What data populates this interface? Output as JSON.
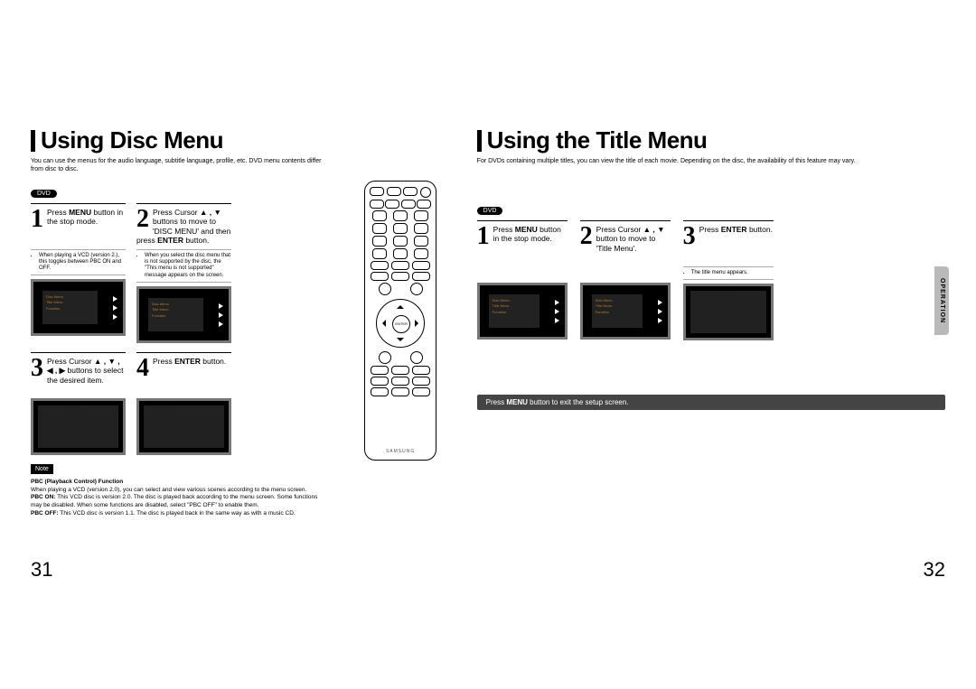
{
  "left": {
    "title": "Using Disc Menu",
    "intro": "You can use the menus for the audio language, subtitle language, profile, etc.\nDVD menu contents differ from disc to disc.",
    "badge": "DVD",
    "steps": [
      {
        "num": "1",
        "text_pre": "Press ",
        "text_b": "MENU",
        "text_post": " button in the stop mode.",
        "note": "When playing a VCD (version 2.), this toggles between PBC ON and OFF."
      },
      {
        "num": "2",
        "text_pre": "Press Cursor ",
        "text_b": "▲ , ▼",
        "text_post": " buttons to move to 'DISC MENU' and then press ",
        "text_b2": "ENTER",
        "text_post2": " button.",
        "note": "When you select the disc menu that is not supported by the disc, the \"This menu is not supported\" message appears on the screen."
      },
      {
        "num": "3",
        "text_pre": "Press Cursor ",
        "text_b": "▲ , ▼ , ◀ , ▶",
        "text_post": " buttons to select the desired item."
      },
      {
        "num": "4",
        "text_pre": "Press ",
        "text_b": "ENTER",
        "text_post": " button."
      }
    ],
    "note_badge": "Note",
    "pbc_title": "PBC (Playback Control) Function",
    "pbc_line1": "When playing a VCD (version 2.0), you can select and view various scenes according to the menu screen.",
    "pbc_on_label": "PBC ON:",
    "pbc_on": "This VCD disc is version 2.0. The disc is played back according to the menu screen. Some functions may be disabled. When some functions are disabled, select \"PBC OFF\" to enable them.",
    "pbc_off_label": "PBC OFF:",
    "pbc_off": "This VCD disc is version 1.1. The disc is played back in the same way as with a music CD.",
    "pagenum": "31",
    "remote_brand": "SAMSUNG",
    "remote_enter": "ENTER"
  },
  "right": {
    "title": "Using the Title Menu",
    "intro": "For DVDs containing multiple titles, you can view the title of each movie.\nDepending on the disc, the availability of this feature may vary.",
    "badge": "DVD",
    "steps": [
      {
        "num": "1",
        "text_pre": "Press ",
        "text_b": "MENU",
        "text_post": " button in the stop mode."
      },
      {
        "num": "2",
        "text_pre": "Press Cursor ",
        "text_b": "▲ , ▼",
        "text_post": " button to move to 'Title Menu'."
      },
      {
        "num": "3",
        "text_pre": "Press ",
        "text_b": "ENTER",
        "text_post": " button.",
        "note": "The title menu appears."
      }
    ],
    "hint_pre": "Press ",
    "hint_b": "MENU",
    "hint_post": " button to exit the setup screen.",
    "op_tab": "OPERATION",
    "pagenum": "32"
  },
  "screen_menu": {
    "l1": "Disc Menu",
    "l2": "Title Menu",
    "l3": "Function"
  }
}
